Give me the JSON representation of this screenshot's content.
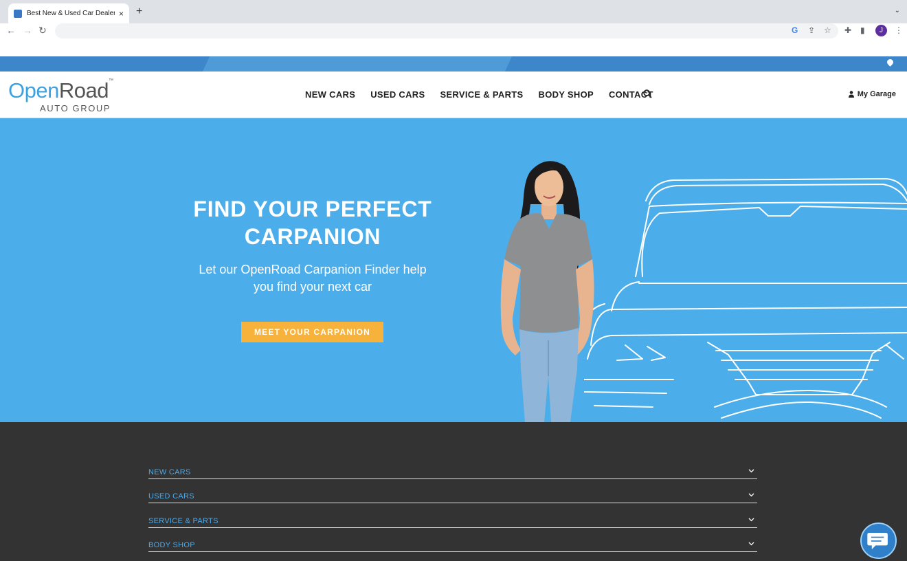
{
  "browser": {
    "tab_title": "Best New & Used Car Dealership",
    "new_tab": "+",
    "close_tab": "×",
    "avatar_letter": "J"
  },
  "site": {
    "logo": {
      "open": "Open",
      "road": "Road",
      "tm": "™",
      "sub": "AUTO GROUP"
    },
    "nav": [
      "NEW CARS",
      "USED CARS",
      "SERVICE & PARTS",
      "BODY SHOP",
      "CONTACT"
    ],
    "garage_label": "My Garage"
  },
  "hero": {
    "title_line1": "FIND YOUR PERFECT",
    "title_line2": "CARPANION",
    "subtitle_line1": "Let our OpenRoad Carpanion Finder help",
    "subtitle_line2": "you find your next car",
    "cta": "MEET YOUR CARPANION"
  },
  "footer": {
    "accordion": [
      "NEW CARS",
      "USED CARS",
      "SERVICE & PARTS",
      "BODY SHOP"
    ]
  },
  "colors": {
    "hero_bg": "#4badea",
    "brand_blue": "#3fa0df",
    "cta": "#f7b23b",
    "footer_bg": "#333333"
  }
}
